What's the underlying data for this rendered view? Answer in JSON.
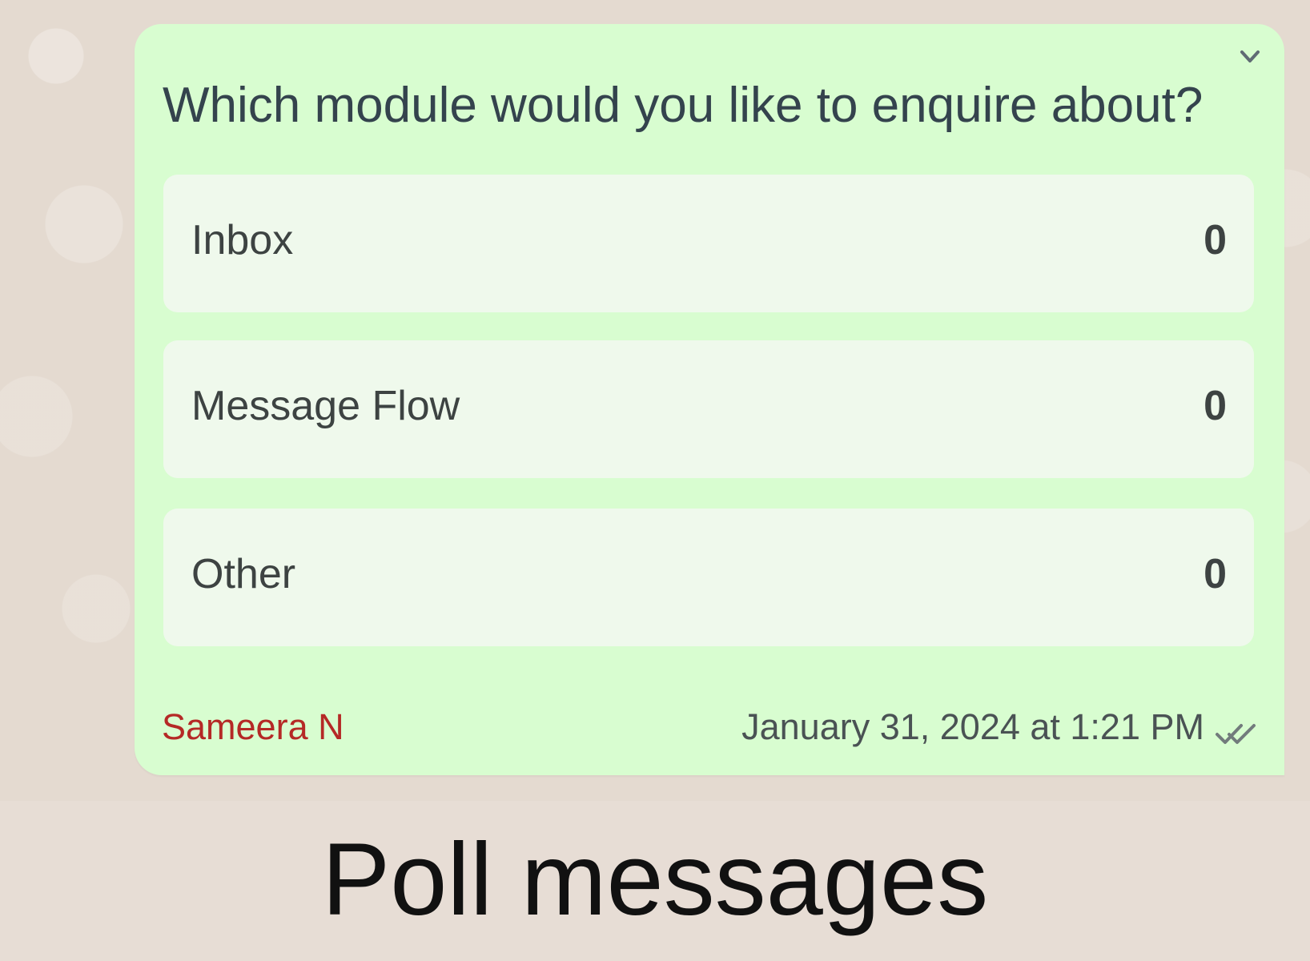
{
  "poll": {
    "question": "Which module would you like to enquire about?",
    "options": [
      {
        "label": "Inbox",
        "count": "0"
      },
      {
        "label": "Message Flow",
        "count": "0"
      },
      {
        "label": "Other",
        "count": "0"
      }
    ],
    "sender": "Sameera N",
    "timestamp": "January 31, 2024 at 1:21 PM",
    "icons": {
      "menu": "chevron-down-icon",
      "status": "double-check-icon"
    },
    "colors": {
      "bubble": "#d8fdd0",
      "option_background": "#eff9ec",
      "sender": "#b52926"
    }
  },
  "caption": "Poll messages"
}
